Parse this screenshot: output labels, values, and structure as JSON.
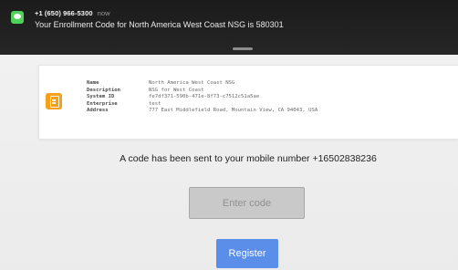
{
  "notification": {
    "sender": "+1 (650) 966-5300",
    "time": "now",
    "message": "Your Enrollment Code for North America West Coast NSG is 580301"
  },
  "card": {
    "icon": "document-icon",
    "fields": [
      {
        "label": "Name",
        "value": "North America West Coast NSG"
      },
      {
        "label": "Description",
        "value": "NSG for West Coast"
      },
      {
        "label": "System ID",
        "value": "fe7df371-590b-471e-8f73-c7512c51a5ae"
      },
      {
        "label": "Enterprise",
        "value": "test"
      },
      {
        "label": "Address",
        "value": "777 East Middlefield Road, Mountain View, CA 94043, USA"
      }
    ]
  },
  "main": {
    "message": "A code has been sent to your mobile number +16502838236",
    "code_placeholder": "Enter code",
    "code_value": "",
    "register_label": "Register"
  },
  "colors": {
    "accent": "#5b8ee8",
    "notification_bg": "#1f1f1f",
    "icon_orange": "#f4a01b",
    "messages_green": "#4fd25a"
  }
}
